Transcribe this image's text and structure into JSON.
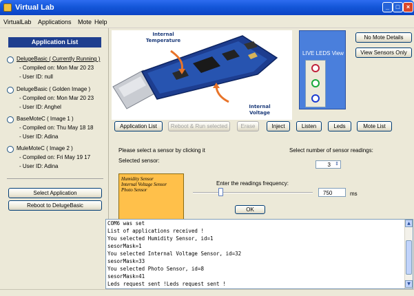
{
  "window": {
    "title": "Virtual Lab"
  },
  "menu": [
    "VirtualLab",
    "Applications",
    "Mote",
    "Help"
  ],
  "app_list": {
    "header": "Application List",
    "entries": [
      {
        "name": "DelugeBasic ( Currently Running )",
        "compiled": "- Compiled on: Mon Mar 20 23",
        "user": "- User ID: null",
        "selected": true
      },
      {
        "name": "DelugeBasic ( Golden Image )",
        "compiled": "- Compiled on: Mon Mar 20 23",
        "user": "- User ID: Anghel",
        "selected": false
      },
      {
        "name": "BaseMoteC ( Image 1 )",
        "compiled": "- Compiled on: Thu May 18 18",
        "user": "- User ID: Adina",
        "selected": false
      },
      {
        "name": "MuleMoteC ( Image 2 )",
        "compiled": "- Compiled on: Fri May 19 17",
        "user": "- User ID: Adina",
        "selected": false
      }
    ],
    "select_button": "Select Application",
    "reboot_button": "Reboot to DelugeBasic"
  },
  "photo": {
    "label_temperature": "Internal\nTemperature",
    "label_voltage": "Internal\nVoltage"
  },
  "right_buttons": {
    "no_mote_details": "No Mote Details",
    "view_sensors_only": "View Sensors Only"
  },
  "leds_panel": {
    "title": "LIVE LEDS View",
    "colors": [
      "#c0203a",
      "#18a838",
      "#1a3ad0"
    ]
  },
  "toolbar": {
    "application_list": "Application List",
    "reboot_run": "Reboot & Run selected",
    "erase": "Erase",
    "inject": "Inject",
    "listen": "Listen",
    "leds": "Leds",
    "mote_list": "Mote List"
  },
  "sensor_panel": {
    "select_prompt": "Please select a sensor by clicking it",
    "selected_label": "Selected sensor:",
    "sensors": [
      "Humidity Sensor",
      "Internal Voltage Sensor",
      "Photo Sensor"
    ],
    "readings_label": "Select number of sensor readings:",
    "readings_value": "3",
    "frequency_label": "Enter the readings frequency:",
    "frequency_value": "750",
    "frequency_unit": "ms",
    "ok_button": "OK"
  },
  "console": [
    "COM6 was set",
    "List of applications received !",
    "You selected Humidity Sensor, id=1",
    "sesorMask=1",
    "You selected Internal Voltage Sensor, id=32",
    "sesorMask=33",
    "You selected Photo Sensor, id=8",
    "sesorMask=41",
    "Leds request sent !Leds request sent !"
  ]
}
